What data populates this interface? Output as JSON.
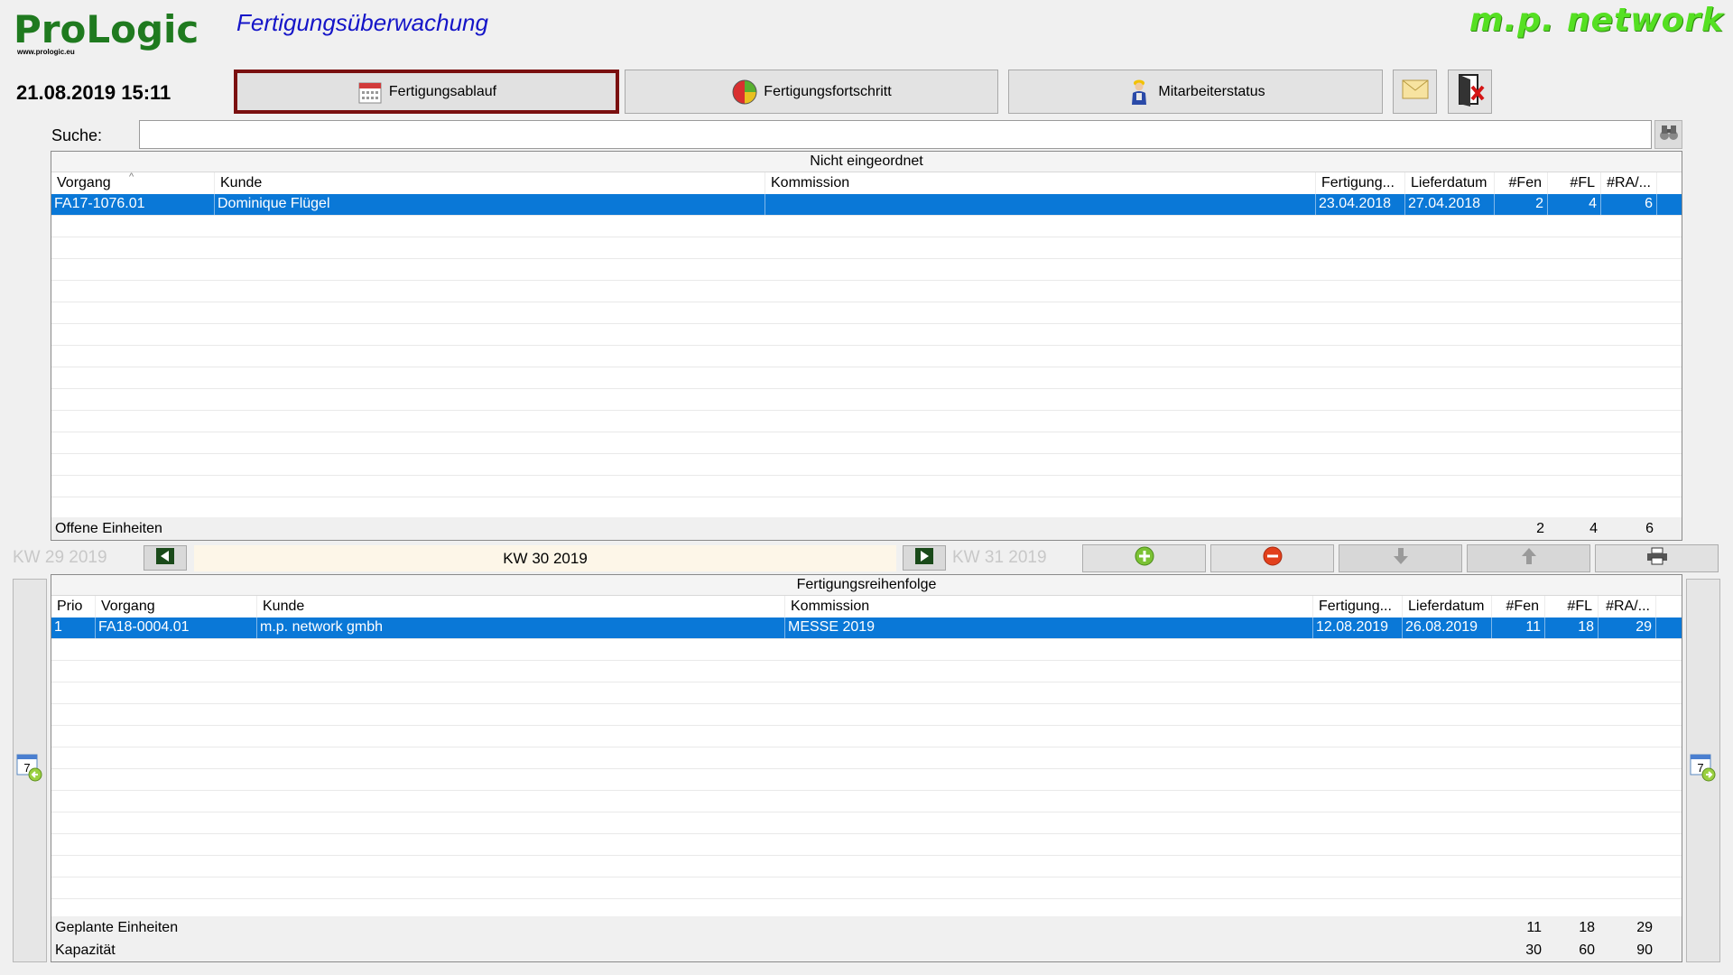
{
  "header": {
    "brand": "ProLogic",
    "brand_url": "www.prologic.eu",
    "app_title": "Fertigungsüberwachung",
    "partner_logo": "m.p. network",
    "datetime": "21.08.2019 15:11"
  },
  "toolbar": {
    "buttons": [
      {
        "label": "Fertigungsablauf",
        "icon": "calendar-icon",
        "active": true
      },
      {
        "label": "Fertigungsfortschritt",
        "icon": "progress-gauge-icon",
        "active": false
      },
      {
        "label": "Mitarbeiterstatus",
        "icon": "worker-icon",
        "active": false
      }
    ],
    "mail_icon": "mail-icon",
    "exit_icon": "exit-door-icon"
  },
  "search": {
    "label": "Suche:",
    "value": "",
    "button_icon": "binoculars-icon"
  },
  "unassigned": {
    "title": "Nicht eingeordnet",
    "columns": [
      "Vorgang",
      "Kunde",
      "Kommission",
      "Fertigung...",
      "Lieferdatum",
      "#Fen",
      "#FL",
      "#RA/..."
    ],
    "sort_indicator": "^",
    "rows": [
      {
        "vorgang": "FA17-1076.01",
        "kunde": "Dominique Flügel",
        "kommission": "",
        "fertigung": "23.04.2018",
        "lieferdatum": "27.04.2018",
        "fen": "2",
        "fl": "4",
        "ra": "6",
        "selected": true
      }
    ],
    "footer": {
      "label": "Offene Einheiten",
      "fen": "2",
      "fl": "4",
      "ra": "6"
    }
  },
  "weekbar": {
    "prev_week": "KW 29 2019",
    "current_week": "KW 30 2019",
    "next_week": "KW 31 2019",
    "actions": [
      {
        "icon": "add-icon",
        "enabled": true
      },
      {
        "icon": "remove-icon",
        "enabled": true
      },
      {
        "icon": "move-down-icon",
        "enabled": false
      },
      {
        "icon": "move-up-icon",
        "enabled": false
      },
      {
        "icon": "print-icon",
        "enabled": true
      }
    ]
  },
  "sequence": {
    "title": "Fertigungsreihenfolge",
    "columns": [
      "Prio",
      "Vorgang",
      "Kunde",
      "Kommission",
      "Fertigung...",
      "Lieferdatum",
      "#Fen",
      "#FL",
      "#RA/..."
    ],
    "rows": [
      {
        "prio": "1",
        "vorgang": "FA18-0004.01",
        "kunde": "m.p. network gmbh",
        "kommission": "MESSE 2019",
        "fertigung": "12.08.2019",
        "lieferdatum": "26.08.2019",
        "fen": "11",
        "fl": "18",
        "ra": "29",
        "selected": true
      }
    ],
    "footer": [
      {
        "label": "Geplante Einheiten",
        "fen": "11",
        "fl": "18",
        "ra": "29"
      },
      {
        "label": "Kapazität",
        "fen": "30",
        "fl": "60",
        "ra": "90"
      }
    ]
  },
  "sidenav": {
    "prev_icon": "calendar-back-icon",
    "next_icon": "calendar-forward-icon",
    "calendar_day": "7"
  },
  "colors": {
    "selection": "#0a78d7",
    "brand_green": "#1f7a1f",
    "title_blue": "#1515c8",
    "active_border": "#7a1010"
  }
}
